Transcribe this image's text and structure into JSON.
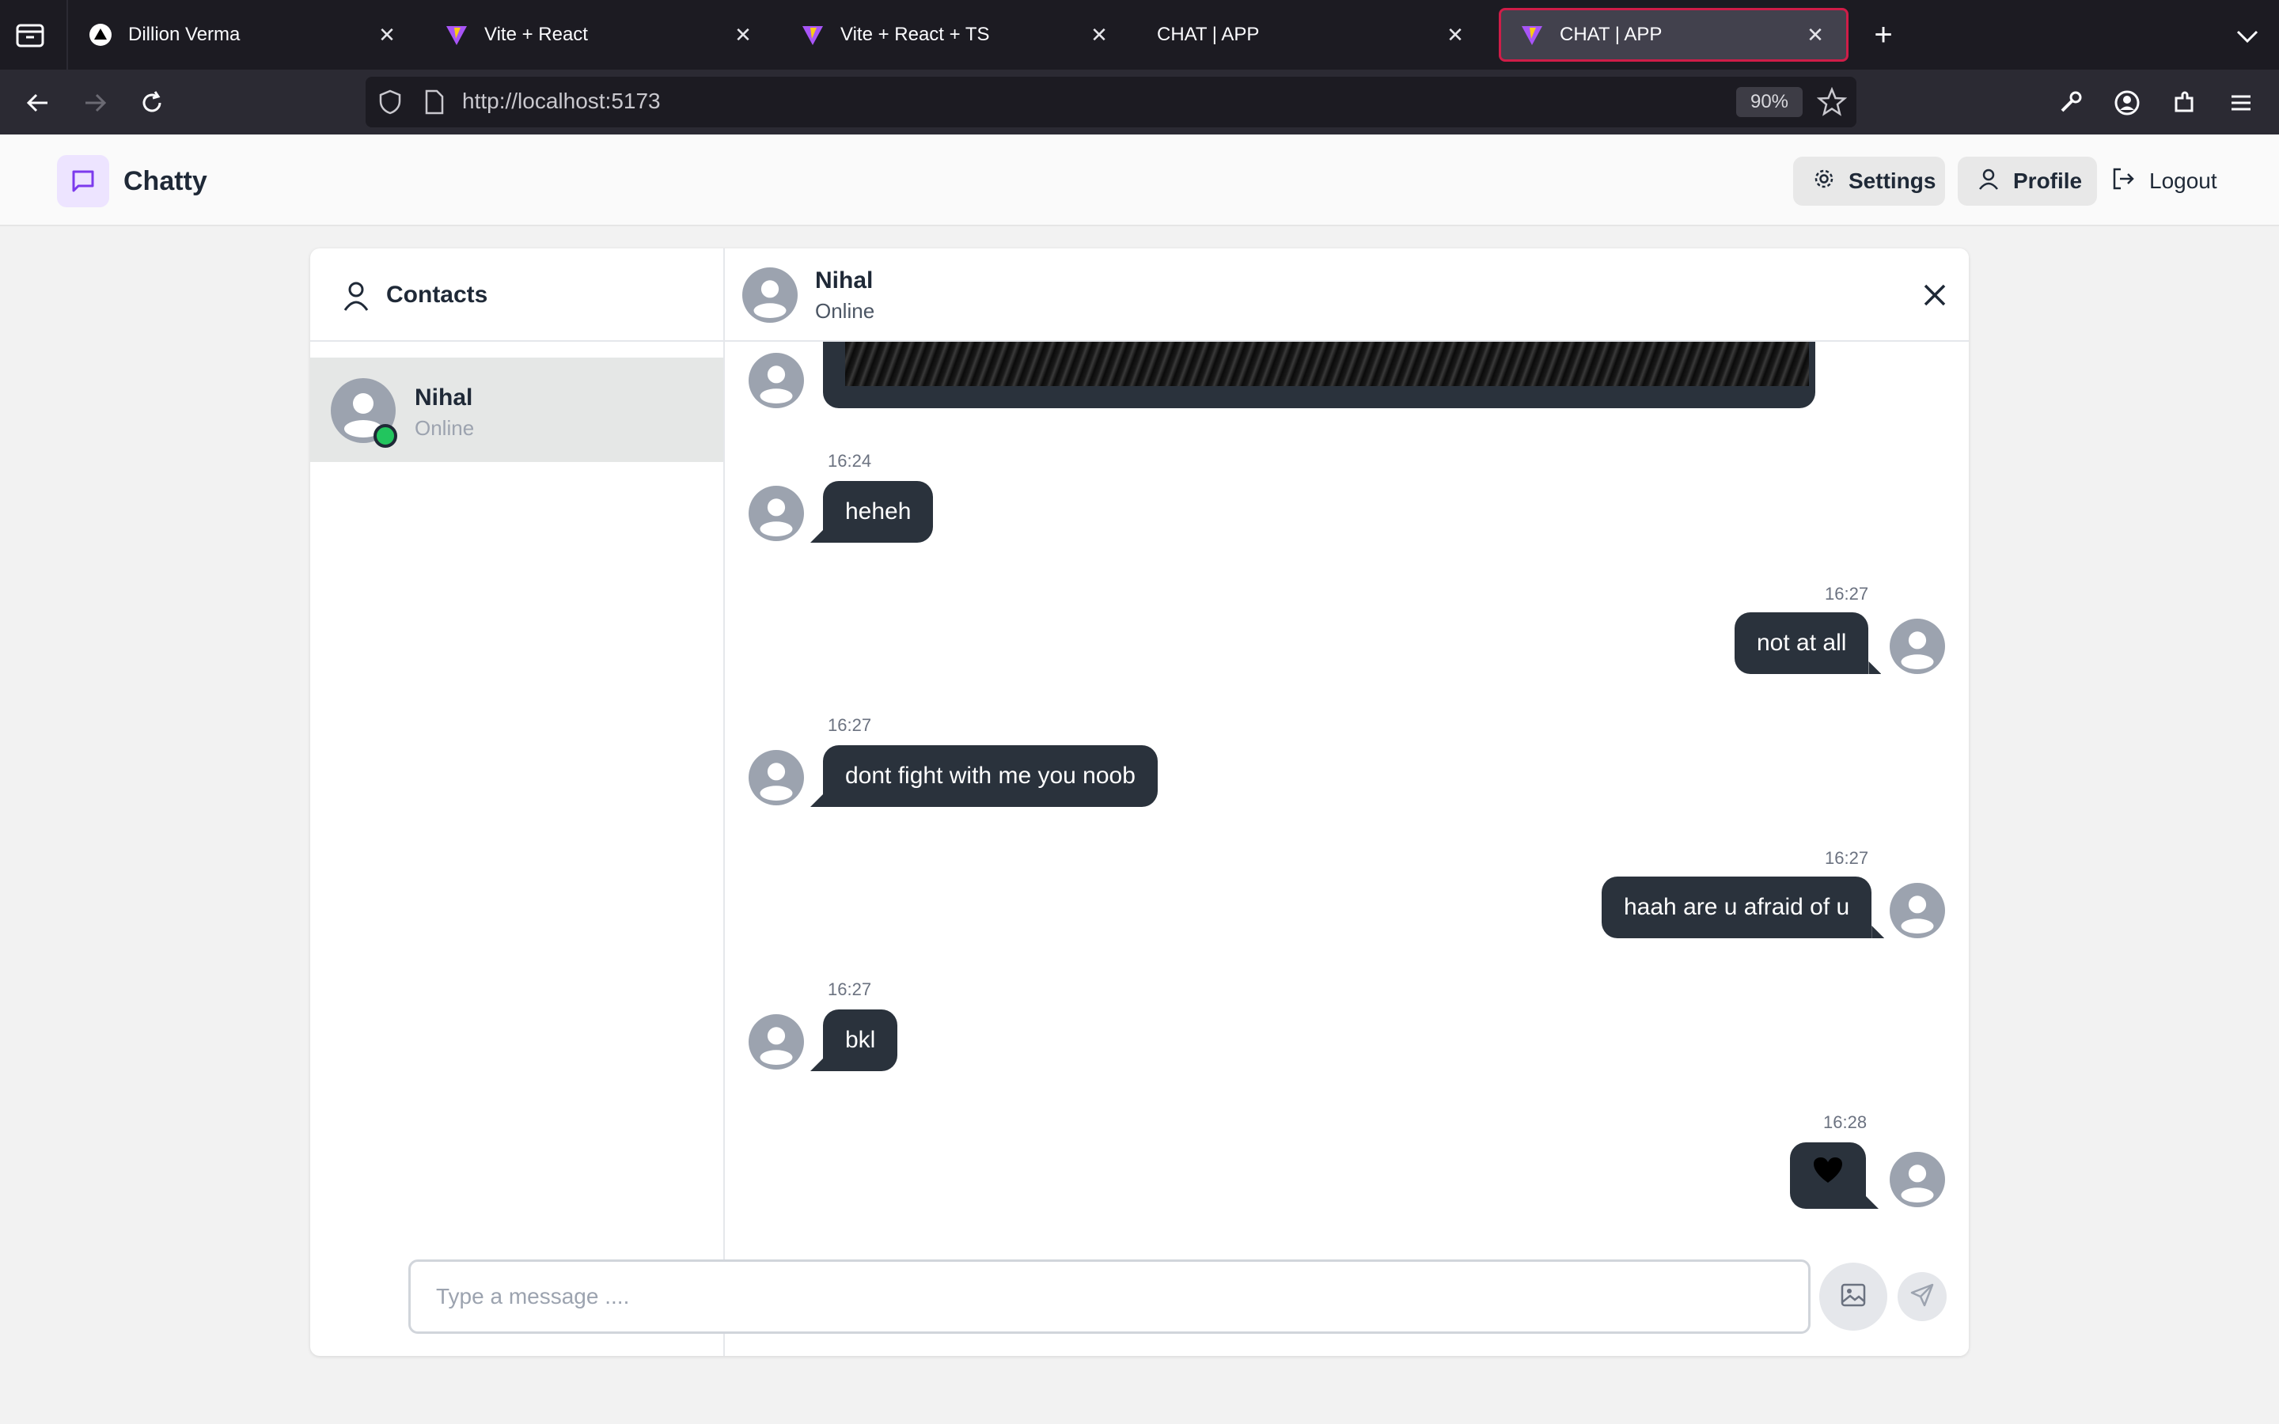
{
  "browser": {
    "tabs": [
      {
        "title": "Dillion Verma",
        "favicon": "triangle-logo-icon"
      },
      {
        "title": "Vite + React",
        "favicon": "vite-icon"
      },
      {
        "title": "Vite + React + TS",
        "favicon": "vite-icon"
      },
      {
        "title": "CHAT | APP",
        "favicon": ""
      },
      {
        "title": "CHAT | APP",
        "favicon": "vite-icon",
        "active": true
      }
    ],
    "url": "http://localhost:5173",
    "zoom": "90%"
  },
  "header": {
    "brand": "Chatty",
    "settings_label": "Settings",
    "profile_label": "Profile",
    "logout_label": "Logout"
  },
  "sidebar": {
    "title": "Contacts",
    "contacts": [
      {
        "name": "Nihal",
        "status": "Online"
      }
    ]
  },
  "chat": {
    "contact_name": "Nihal",
    "contact_status": "Online",
    "messages": [
      {
        "side": "left",
        "time": "16:24",
        "text": "heheh"
      },
      {
        "side": "right",
        "time": "16:27",
        "text": "not at all"
      },
      {
        "side": "left",
        "time": "16:27",
        "text": "dont fight with me you noob"
      },
      {
        "side": "right",
        "time": "16:27",
        "text": "haah are u afraid of u"
      },
      {
        "side": "left",
        "time": "16:27",
        "text": "bkl"
      },
      {
        "side": "right",
        "time": "16:28",
        "text": "♥"
      }
    ],
    "input_placeholder": "Type a message ...."
  },
  "colors": {
    "accent": "#cf1d48",
    "bubble": "#2a323c",
    "online": "#22c55e",
    "brand_bg": "#ede4ff"
  }
}
